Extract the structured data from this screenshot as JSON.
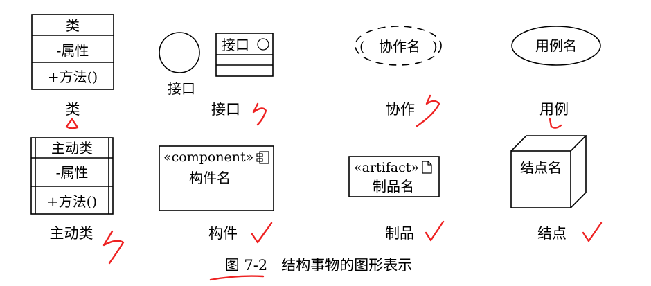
{
  "class_box": {
    "name": "类",
    "attribute": "-属性",
    "method": "+方法()",
    "caption": "类"
  },
  "interface": {
    "circle_label": "接口",
    "box_label": "接口",
    "caption": "接口"
  },
  "collaboration": {
    "name": "协作名",
    "open_paren": "(",
    "close_paren": ")",
    "caption": "协作"
  },
  "use_case": {
    "name": "用例名",
    "caption": "用例"
  },
  "active_class": {
    "name": "主动类",
    "attribute": "-属性",
    "method": "+方法()",
    "caption": "主动类"
  },
  "component": {
    "stereotype": "«component»",
    "name": "构件名",
    "caption": "构件"
  },
  "artifact": {
    "stereotype": "«artifact»",
    "name": "制品名",
    "caption": "制品"
  },
  "node": {
    "name": "结点名",
    "caption": "结点"
  },
  "figure_caption": "图 7-2   结构事物的图形表示",
  "colors": {
    "ink": "#ee2222",
    "line": "#000000"
  }
}
